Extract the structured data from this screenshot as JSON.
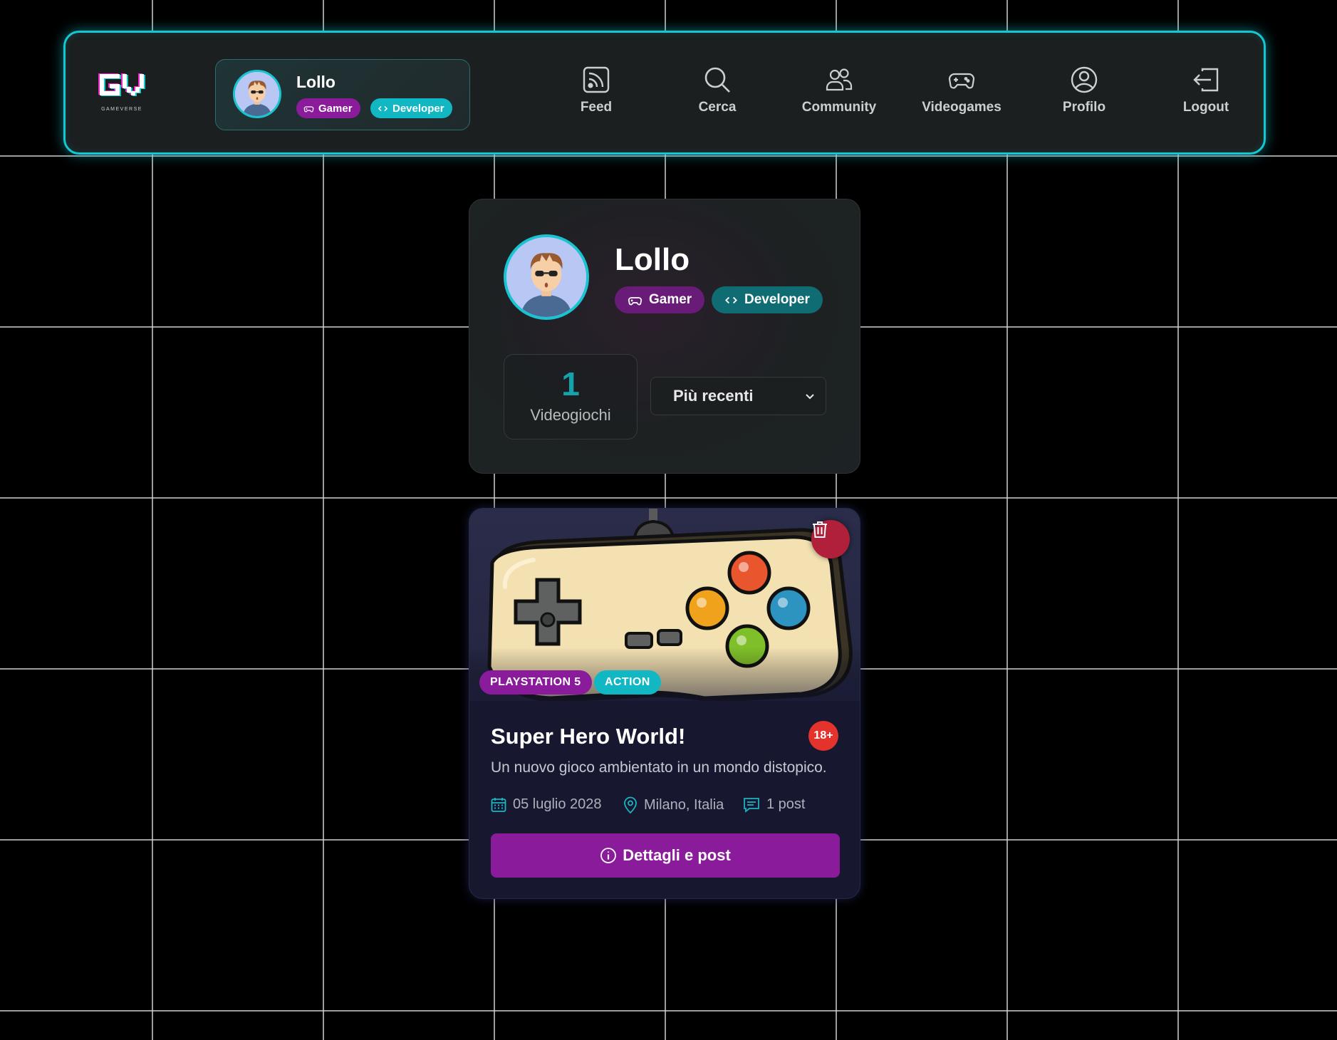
{
  "navbar": {
    "logo_text": "GV",
    "logo_subtext": "GAMEVERSE",
    "user": {
      "name": "Lollo",
      "badges": {
        "gamer": "Gamer",
        "developer": "Developer"
      }
    },
    "items": [
      {
        "label": "Feed",
        "icon": "rss-icon"
      },
      {
        "label": "Cerca",
        "icon": "search-icon"
      },
      {
        "label": "Community",
        "icon": "users-icon"
      },
      {
        "label": "Videogames",
        "icon": "gamepad-icon"
      },
      {
        "label": "Profilo",
        "icon": "user-circle-icon"
      },
      {
        "label": "Logout",
        "icon": "logout-icon"
      }
    ]
  },
  "profile": {
    "name": "Lollo",
    "badges": {
      "gamer": "Gamer",
      "developer": "Developer"
    },
    "stats": {
      "count": "1",
      "label": "Videogiochi"
    },
    "sort": {
      "selected": "Più recenti"
    }
  },
  "game": {
    "platform": "PLAYSTATION 5",
    "genre": "ACTION",
    "title": "Super Hero World!",
    "age_rating": "18+",
    "description": "Un nuovo gioco ambientato in un mondo distopico.",
    "date": "05 luglio 2028",
    "location": "Milano, Italia",
    "posts": "1 post",
    "details_label": "Dettagli e post"
  },
  "colors": {
    "accent_cyan": "#12c9d3",
    "accent_purple": "#8a1c9b",
    "danger": "#b1203a",
    "age_badge": "#e3332c"
  }
}
